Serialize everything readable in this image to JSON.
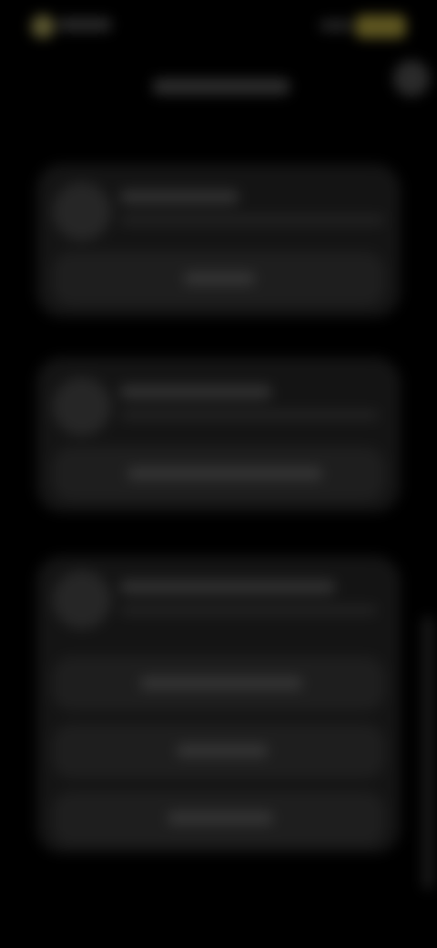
{
  "status_bar": {
    "time": "",
    "colors": {
      "indicator": "#5a5630",
      "battery": "#5d5520"
    }
  },
  "header": {
    "title": "",
    "action_icon": "menu-icon"
  },
  "cards": [
    {
      "icon": "circle-icon",
      "title": "",
      "subtitle": "",
      "buttons": [
        ""
      ]
    },
    {
      "icon": "circle-icon",
      "title": "",
      "subtitle": "",
      "buttons": [
        ""
      ]
    },
    {
      "icon": "circle-icon",
      "title": "",
      "subtitle": "",
      "buttons": [
        "",
        "",
        ""
      ]
    }
  ],
  "theme": {
    "background": "#000000",
    "card": "#141414",
    "button": "#1e1e1e"
  }
}
